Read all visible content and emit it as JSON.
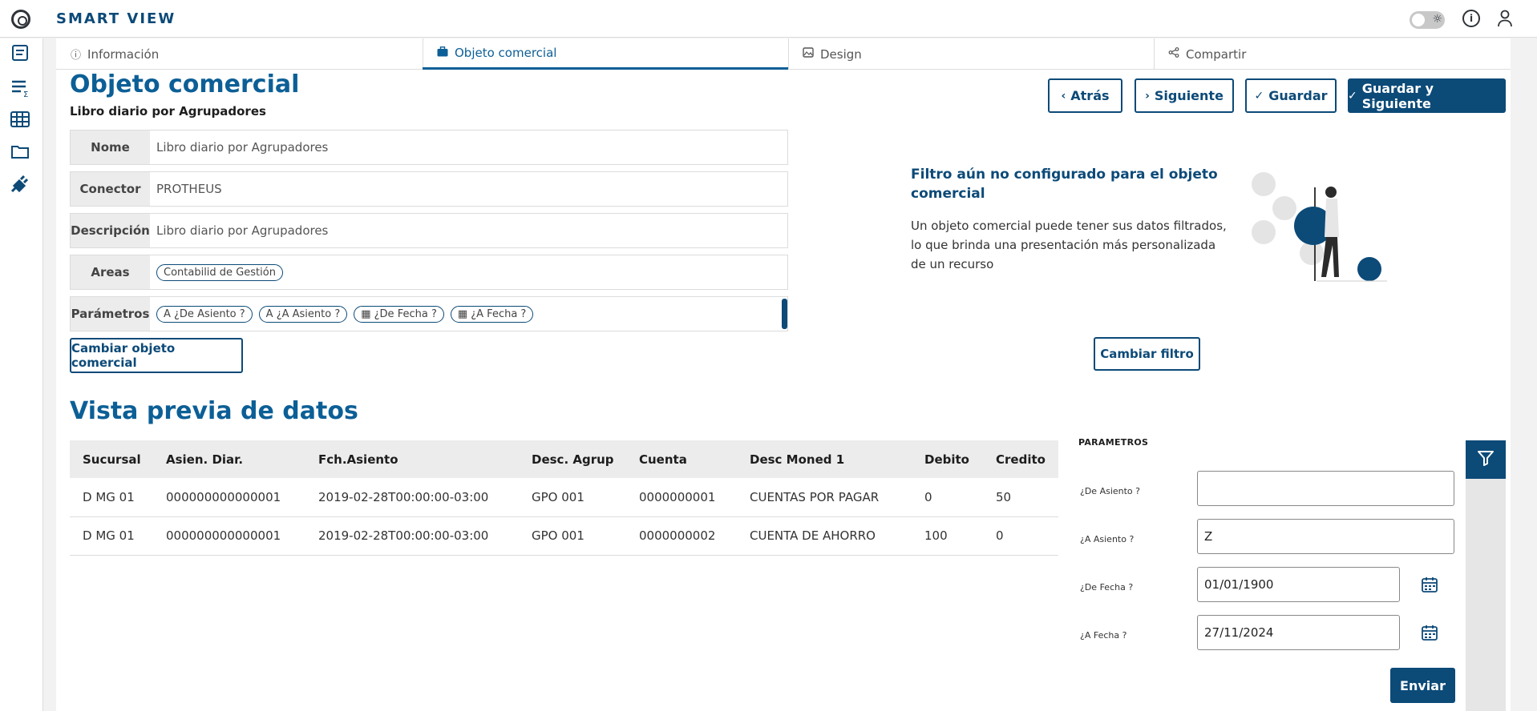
{
  "app": {
    "title": "SMART VIEW"
  },
  "tabs": [
    {
      "label": "Información",
      "icon": "info-icon"
    },
    {
      "label": "Objeto comercial",
      "icon": "briefcase-icon"
    },
    {
      "label": "Design",
      "icon": "image-icon"
    },
    {
      "label": "Compartir",
      "icon": "share-icon"
    }
  ],
  "page": {
    "title": "Objeto comercial",
    "subtitle": "Libro diario por Agrupadores"
  },
  "fields": {
    "nome": {
      "label": "Nome",
      "value": "Libro diario por Agrupadores"
    },
    "conector": {
      "label": "Conector",
      "value": "PROTHEUS"
    },
    "descripcion": {
      "label": "Descripción",
      "value": "Libro diario por Agrupadores"
    },
    "areas": {
      "label": "Areas",
      "chips": [
        "Contabilid de Gestión"
      ]
    },
    "parametros": {
      "label": "Parámetros",
      "chips": [
        "A ¿De Asiento ?",
        "A ¿A Asiento ?",
        "▦ ¿De Fecha ?",
        "▦ ¿A Fecha ?"
      ]
    }
  },
  "buttons": {
    "back": "Atrás",
    "next": "Siguiente",
    "save": "Guardar",
    "save_next": "Guardar y Siguiente",
    "change_object": "Cambiar objeto comercial",
    "change_filter": "Cambiar filtro",
    "send": "Enviar"
  },
  "filter": {
    "title": "Filtro aún no configurado para el objeto comercial",
    "description": "Un objeto comercial puede tener sus datos filtrados, lo que brinda una presentación más personalizada de un recurso"
  },
  "preview": {
    "title": "Vista previa de datos",
    "columns": [
      "Sucursal",
      "Asien. Diar.",
      "Fch.Asiento",
      "Desc. Agrup",
      "Cuenta",
      "Desc Moned 1",
      "Debito",
      "Credito"
    ],
    "rows": [
      [
        "D MG 01",
        "000000000000001",
        "2019-02-28T00:00:00-03:00",
        "GPO 001",
        "0000000001",
        "CUENTAS POR PAGAR",
        "0",
        "50"
      ],
      [
        "D MG 01",
        "000000000000001",
        "2019-02-28T00:00:00-03:00",
        "GPO 001",
        "0000000002",
        "CUENTA DE AHORRO",
        "100",
        "0"
      ]
    ]
  },
  "params": {
    "title": "PARAMETROS",
    "items": [
      {
        "label": "¿De Asiento ?",
        "value": ""
      },
      {
        "label": "¿A Asiento ?",
        "value": "Z"
      },
      {
        "label": "¿De Fecha ?",
        "value": "01/01/1900"
      },
      {
        "label": "¿A Fecha ?",
        "value": "27/11/2024"
      }
    ]
  }
}
